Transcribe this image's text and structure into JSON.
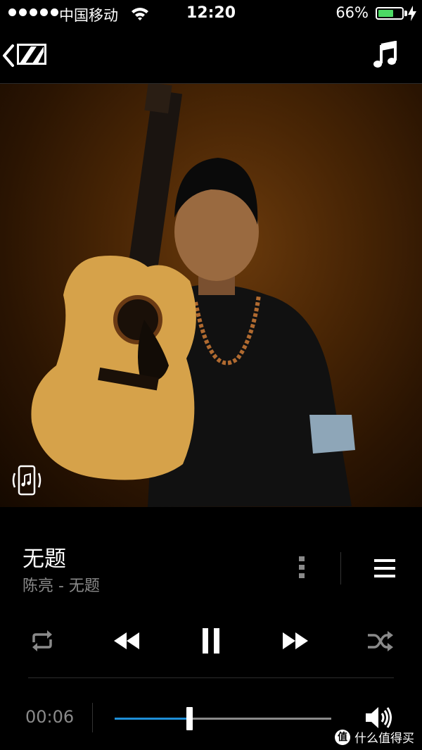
{
  "status_bar": {
    "carrier": "中国移动",
    "time": "12:20",
    "battery_percent": "66%",
    "battery_level": 0.66
  },
  "nav": {
    "back_icon": "chevron-left",
    "logo_icon": "sennheiser-logo",
    "music_icon": "music-note"
  },
  "album": {
    "device_icon": "phone-with-music"
  },
  "track": {
    "title": "无题",
    "subtitle": "陈亮 - 无题"
  },
  "controls": {
    "repeat": "repeat-icon",
    "previous": "rewind-icon",
    "play_state": "pause-icon",
    "next": "fast-forward-icon",
    "shuffle": "shuffle-icon"
  },
  "progress": {
    "elapsed": "00:06",
    "fraction": 0.345
  },
  "colors": {
    "accent": "#1e8fd8",
    "battery": "#4cd964",
    "secondary_text": "#8a8a8a"
  },
  "watermark": {
    "logo_glyph": "值",
    "text": "什么值得买"
  }
}
